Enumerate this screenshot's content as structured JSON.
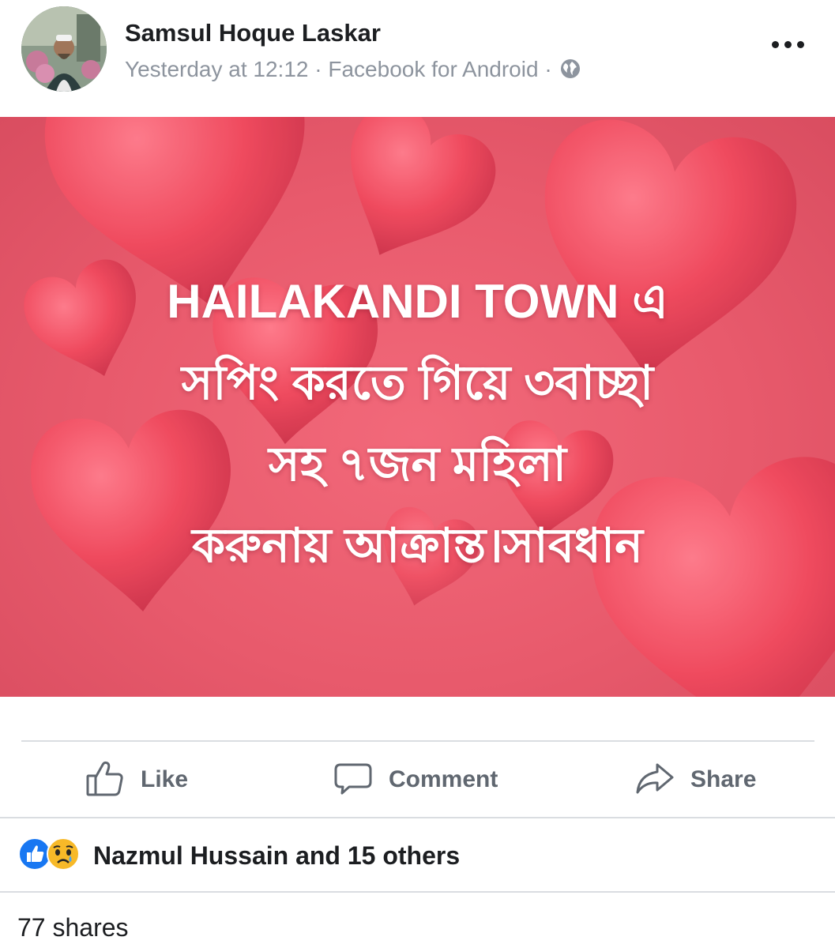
{
  "post": {
    "author": "Samsul Hoque Laskar",
    "time": "Yesterday at 12:12",
    "separator": "·",
    "source": "Facebook for Android",
    "privacy_icon": "globe-icon",
    "image_text": [
      "HAILAKANDI TOWN এ",
      "সপিং করতে গিয়ে ৩বাচ্ছা",
      "সহ ৭জন মহিলা",
      "করুনায় আক্রান্ত।সাবধান"
    ]
  },
  "actions": {
    "like": "Like",
    "comment": "Comment",
    "share": "Share"
  },
  "reactions": {
    "icons": [
      "like-reaction-icon",
      "sad-reaction-icon"
    ],
    "names": "Nazmul Hussain and 15 others"
  },
  "shares": "77 shares",
  "colors": {
    "image_background": "#e85a6c",
    "heart": "#f04a5e",
    "like_blue": "#1877f2",
    "secondary_text": "#8d949e"
  }
}
